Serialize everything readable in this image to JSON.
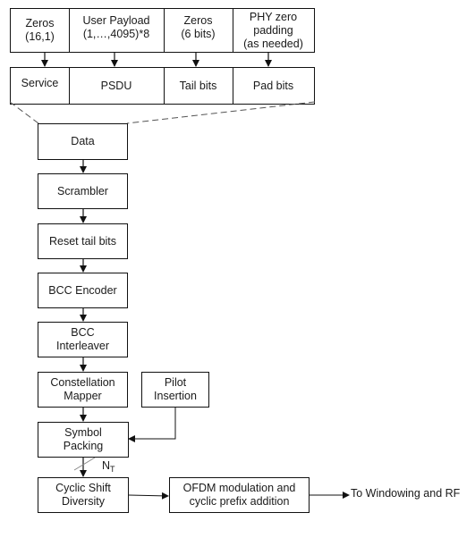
{
  "diagram": {
    "type": "block-diagram",
    "title": "",
    "top_row": [
      {
        "id": "zeros-service",
        "label": "Zeros\n(16,1)"
      },
      {
        "id": "user-payload",
        "label": "User Payload\n(1,…,4095)*8"
      },
      {
        "id": "zeros-tail",
        "label": "Zeros\n(6 bits)"
      },
      {
        "id": "phy-zero-padding",
        "label": "PHY zero\npadding\n(as needed)"
      }
    ],
    "field_row": [
      {
        "id": "service",
        "label": "Service"
      },
      {
        "id": "psdu",
        "label": "PSDU"
      },
      {
        "id": "tail-bits",
        "label": "Tail bits"
      },
      {
        "id": "pad-bits",
        "label": "Pad bits"
      }
    ],
    "chain": [
      {
        "id": "data",
        "label": "Data"
      },
      {
        "id": "scrambler",
        "label": "Scrambler"
      },
      {
        "id": "reset-tail-bits",
        "label": "Reset tail bits"
      },
      {
        "id": "bcc-encoder",
        "label": "BCC Encoder"
      },
      {
        "id": "bcc-interleaver",
        "label": "BCC\nInterleaver"
      },
      {
        "id": "constellation-mapper",
        "label": "Constellation\nMapper"
      },
      {
        "id": "symbol-packing",
        "label": "Symbol\nPacking"
      },
      {
        "id": "cyclic-shift-diversity",
        "label": "Cyclic Shift\nDiversity"
      }
    ],
    "side_blocks": [
      {
        "id": "pilot-insertion",
        "label": "Pilot\nInsertion"
      },
      {
        "id": "ofdm-modulation",
        "label": "OFDM modulation and\ncyclic prefix addition"
      }
    ],
    "stream_label": {
      "main": "N",
      "sub": "T"
    },
    "output_label": "To Windowing and RF",
    "edges": [
      [
        "zeros-service",
        "service"
      ],
      [
        "user-payload",
        "psdu"
      ],
      [
        "zeros-tail",
        "tail-bits"
      ],
      [
        "phy-zero-padding",
        "pad-bits"
      ],
      [
        "data",
        "scrambler"
      ],
      [
        "scrambler",
        "reset-tail-bits"
      ],
      [
        "reset-tail-bits",
        "bcc-encoder"
      ],
      [
        "bcc-encoder",
        "bcc-interleaver"
      ],
      [
        "bcc-interleaver",
        "constellation-mapper"
      ],
      [
        "constellation-mapper",
        "symbol-packing"
      ],
      [
        "pilot-insertion",
        "symbol-packing"
      ],
      [
        "symbol-packing",
        "cyclic-shift-diversity"
      ],
      [
        "cyclic-shift-diversity",
        "ofdm-modulation"
      ],
      [
        "ofdm-modulation",
        "output"
      ]
    ]
  }
}
